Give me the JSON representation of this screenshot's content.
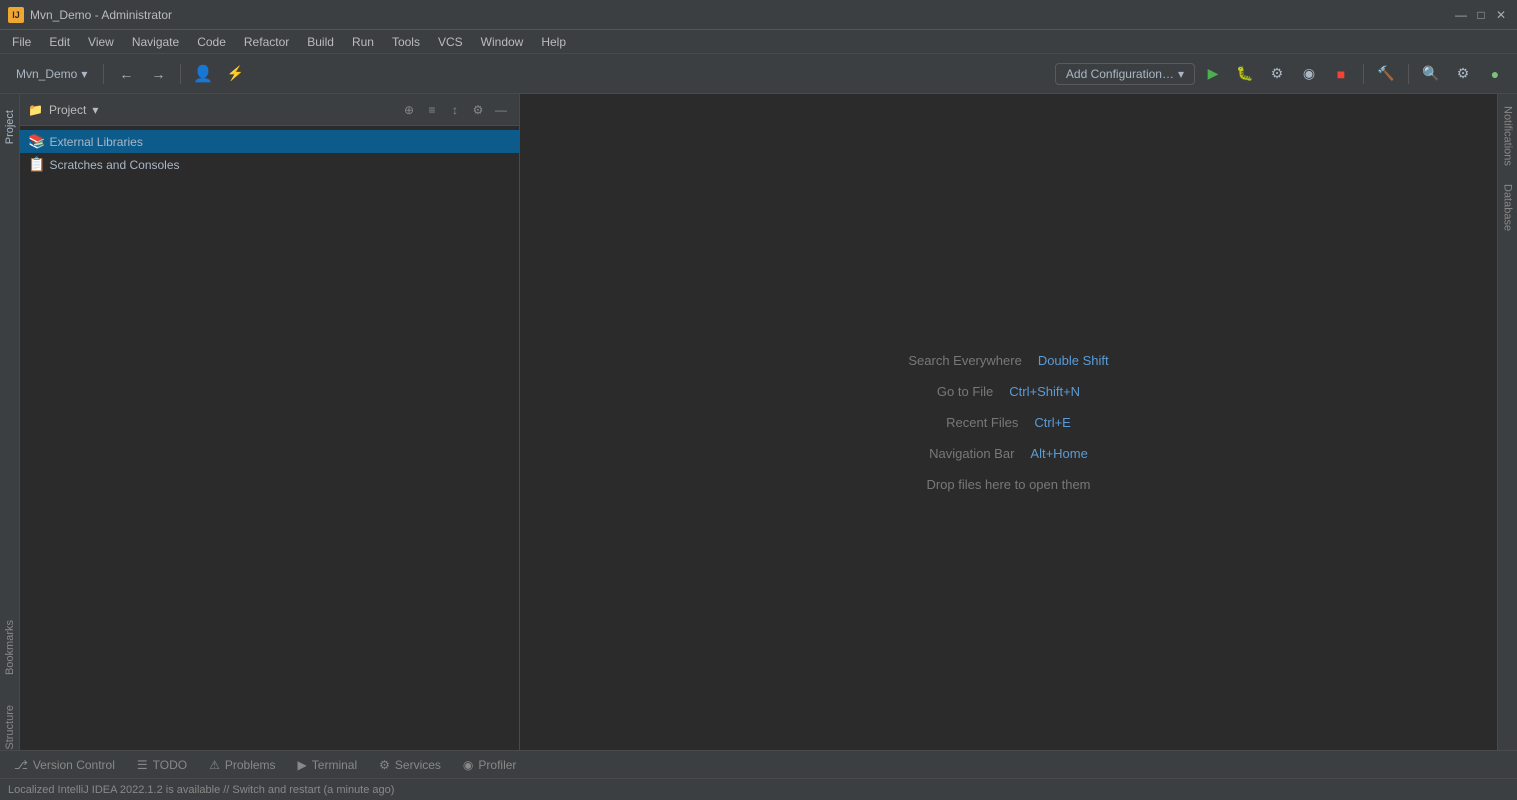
{
  "titlebar": {
    "title": "Mvn_Demo - Administrator",
    "icon_text": "IJ",
    "controls": {
      "minimize": "—",
      "maximize": "□",
      "close": "✕"
    }
  },
  "menubar": {
    "items": [
      "File",
      "Edit",
      "View",
      "Navigate",
      "Code",
      "Refactor",
      "Build",
      "Run",
      "Tools",
      "VCS",
      "Window",
      "Help"
    ]
  },
  "toolbar": {
    "project_name": "Mvn_Demo",
    "add_config_label": "Add Configuration…",
    "nav_back": "←",
    "nav_forward": "→",
    "dropdown_arrow": "▾"
  },
  "project_panel": {
    "title": "Project",
    "dropdown_arrow": "▾",
    "tree": [
      {
        "label": "External Libraries",
        "icon": "📚",
        "selected": true,
        "indent": 0
      },
      {
        "label": "Scratches and Consoles",
        "icon": "📋",
        "selected": false,
        "indent": 0
      }
    ],
    "actions": [
      "⊕",
      "≡",
      "≤",
      "⚙",
      "—"
    ]
  },
  "editor": {
    "hints": [
      {
        "text": "Search Everywhere",
        "shortcut": "Double Shift"
      },
      {
        "text": "Go to File",
        "shortcut": "Ctrl+Shift+N"
      },
      {
        "text": "Recent Files",
        "shortcut": "Ctrl+E"
      },
      {
        "text": "Navigation Bar",
        "shortcut": "Alt+Home"
      },
      {
        "text": "Drop files here to open them",
        "shortcut": ""
      }
    ]
  },
  "bottom_tabs": [
    {
      "label": "Version Control",
      "icon": "⎇",
      "active": false
    },
    {
      "label": "TODO",
      "icon": "☰",
      "active": false
    },
    {
      "label": "Problems",
      "icon": "⚠",
      "active": false
    },
    {
      "label": "Terminal",
      "icon": "▶",
      "active": false
    },
    {
      "label": "Services",
      "icon": "⚙",
      "active": false
    },
    {
      "label": "Profiler",
      "icon": "◉",
      "active": false
    }
  ],
  "status_bar": {
    "text": "Localized IntelliJ IDEA 2022.1.2 is available // Switch and restart (a minute ago)"
  },
  "sidebar_left": {
    "tabs": [
      "Project",
      "Bookmarks",
      "Structure"
    ]
  },
  "sidebar_right": {
    "tabs": [
      "Notifications",
      "Database"
    ]
  }
}
